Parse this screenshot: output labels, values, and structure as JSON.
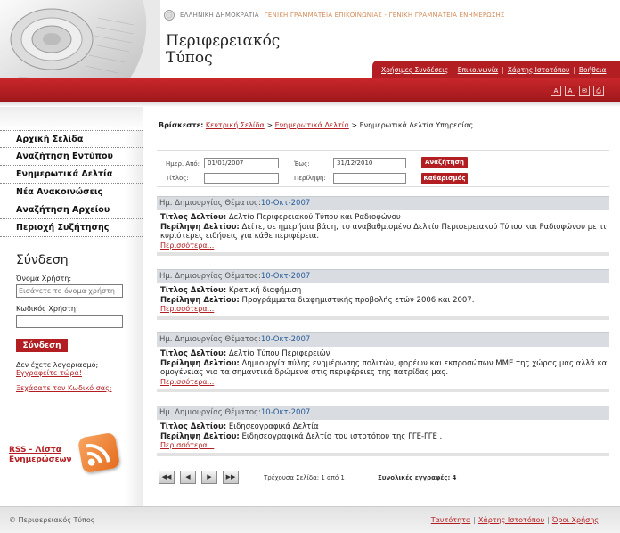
{
  "header": {
    "gov_text_1": "ΕΛΛΗΝΙΚΗ ΔΗΜΟΚΡΑΤΙΑ",
    "gov_text_2": "ΓΕΝΙΚΗ ΓΡΑΜΜΑΤΕΙΑ ΕΠΙΚΟΙΝΩΝΙΑΣ - ΓΕΝΙΚΗ ΓΡΑΜΜΑΤΕΙΑ ΕΝΗΜΕΡΩΣΗΣ",
    "title_line1": "Περιφερειακός",
    "title_line2": "Τύπος",
    "nav": [
      "Χρήσιμες Συνδέσεις",
      "Επικοινωνία",
      "Χάρτης Ιστοτόπου",
      "Βοήθεια"
    ],
    "tools": [
      "A",
      "A",
      "✉",
      "⎙"
    ]
  },
  "sidebar": {
    "menu": [
      "Αρχική Σελίδα",
      "Αναζήτηση Εντύπου",
      "Ενημερωτικά Δελτία",
      "Νέα Ανακοινώσεις",
      "Αναζήτηση Αρχείου",
      "Περιοχή Συζήτησης"
    ],
    "login": {
      "title": "Σύνδεση",
      "username_label": "Όνομα Χρήστη:",
      "username_placeholder": "Εισάγετε το όνομα χρήστη",
      "password_label": "Κωδικός Χρήστη:",
      "button": "Σύνδεση",
      "no_account": "Δεν έχετε λογαριασμό;",
      "register": "Εγγραφείτε τώρα!",
      "forgot": "Ξεχάσατε τον Κωδικό σας;"
    },
    "rss_line1": "RSS - Λίστα",
    "rss_line2": "Ενημερώσεων"
  },
  "breadcrumb": {
    "prefix": "Βρίσκεστε:",
    "home": "Κεντρική Σελίδα",
    "sep": ">",
    "section": "Ενημερωτικά Δελτία",
    "current": "Ενημερωτικά Δελτία Υπηρεσίας"
  },
  "search": {
    "from_label": "Ημερ. Από:",
    "from_value": "01/01/2007",
    "to_label": "Έως:",
    "to_value": "31/12/2010",
    "title_label": "Τίτλος:",
    "summary_label": "Περίληψη:",
    "search_button": "Αναζήτηση",
    "clear_button": "Καθαρισμός"
  },
  "labels": {
    "created": "Ημ. Δημιουργίας Θέματος:",
    "title": "Τίτλος Δελτίου:",
    "summary": "Περίληψη Δελτίου:",
    "more": "Περισσότερα..."
  },
  "bulletins": [
    {
      "date": "10-Οκτ-2007",
      "title": "Δελτίο Περιφερειακού Τύπου και Ραδιοφώνου",
      "summary_1": "Δείτε, σε ημερήσια βάση, το αναβαθμισμένο Δελτίο Περιφερειακού Τύπου και Ραδιοφώνου με τις",
      "summary_2": "κυριότερες ειδήσεις για κάθε περιφέρεια."
    },
    {
      "date": "10-Οκτ-2007",
      "title": "Κρατική διαφήμιση",
      "summary_1": "Προγράμματα διαφημιστικής προβολής ετών 2006 και 2007.",
      "summary_2": ""
    },
    {
      "date": "10-Οκτ-2007",
      "title": "Δελτίο Τύπου Περιφερειών",
      "summary_1": "Δημιουργία πύλης ενημέρωσης πολιτών, φορέων και εκπροσώπων ΜΜΕ της χώρας μας αλλά και της",
      "summary_2": "ομογένειας για τα σημαντικά δρώμενα στις περιφέρειες της πατρίδας μας."
    },
    {
      "date": "10-Οκτ-2007",
      "title": "Ειδησεογραφικά Δελτία",
      "summary_1": "Ειδησεογραφικά Δελτία του ιστοτόπου της ΓΓΕ-ΓΓΕ .",
      "summary_2": ""
    }
  ],
  "pager": {
    "first": "◀◀",
    "prev": "◀",
    "next": "▶",
    "last": "▶▶",
    "page_text": "Τρέχουσα Σελίδα: 1 από 1",
    "total_label": "Συνολικές εγγραφές:",
    "total_value": "4"
  },
  "footer": {
    "copyright": "© Περιφερειακός Τύπος",
    "links": [
      "Ταυτότητα",
      "Χάρτης Ιστοτόπου",
      "Όροι Χρήσης"
    ],
    "sep": "|"
  }
}
